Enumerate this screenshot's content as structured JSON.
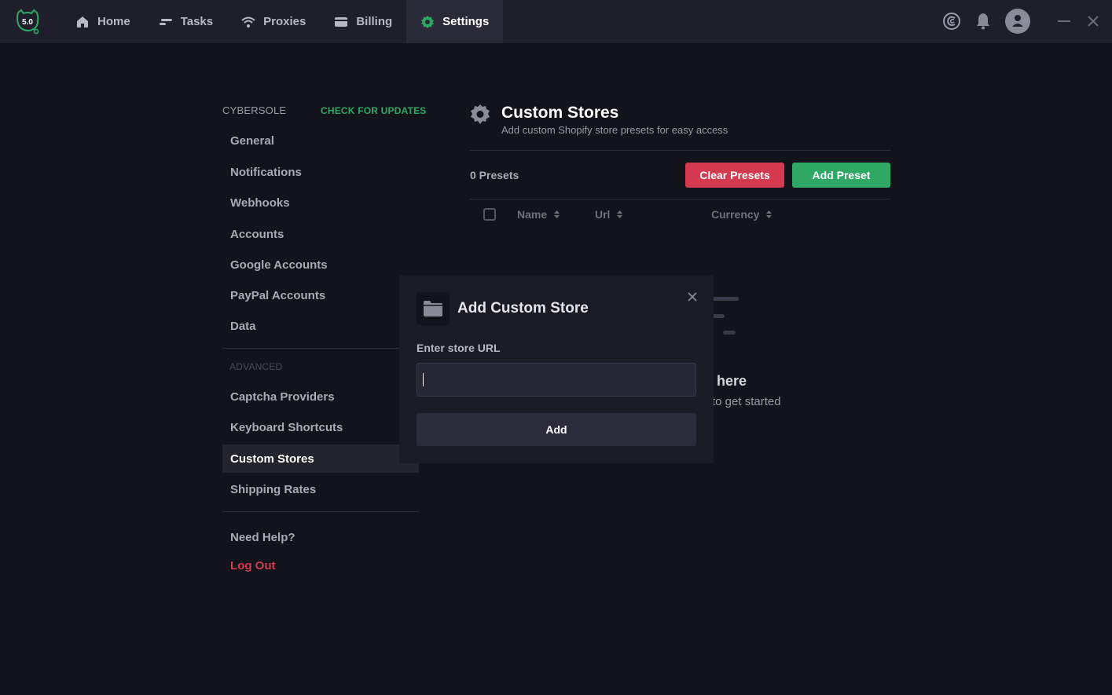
{
  "app": {
    "logo_text": "5.0"
  },
  "nav": {
    "home": "Home",
    "tasks": "Tasks",
    "proxies": "Proxies",
    "billing": "Billing",
    "settings": "Settings"
  },
  "sidebar": {
    "brand": "CYBERSOLE",
    "check_updates": "CHECK FOR UPDATES",
    "items": [
      "General",
      "Notifications",
      "Webhooks",
      "Accounts",
      "Google Accounts",
      "PayPal Accounts",
      "Data"
    ],
    "advanced_label": "ADVANCED",
    "advanced_items": [
      "Captcha Providers",
      "Keyboard Shortcuts",
      "Custom Stores",
      "Shipping Rates"
    ],
    "help": "Need Help?",
    "logout": "Log Out"
  },
  "main": {
    "title": "Custom Stores",
    "subtitle": "Add custom Shopify store presets for easy access",
    "presets_count": "0 Presets",
    "clear_button": "Clear Presets",
    "add_button": "Add Preset",
    "columns": [
      "Name",
      "Url",
      "Currency"
    ],
    "empty_title_fragment": "here",
    "empty_sub_fragment": "to get started"
  },
  "modal": {
    "title": "Add Custom Store",
    "label": "Enter store URL",
    "input_value": "",
    "submit": "Add"
  },
  "colors": {
    "accent": "#2ea864",
    "danger": "#d33a4f",
    "background": "#13131b"
  }
}
